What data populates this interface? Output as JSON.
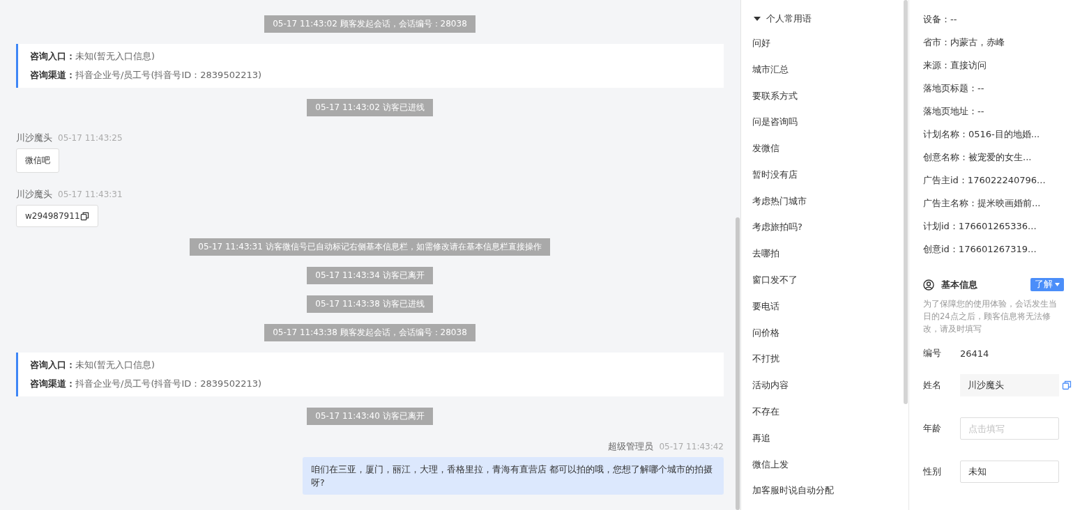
{
  "chat": [
    {
      "kind": "system",
      "text": "05-17 11:43:02 顾客发起会话，会话编号：28038"
    },
    {
      "kind": "info_card",
      "lines": [
        {
          "label": "咨询入口：",
          "value": "未知(暂无入口信息)"
        },
        {
          "label": "咨询渠道：",
          "value": "抖音企业号/员工号(抖音号ID：2839502213)"
        }
      ]
    },
    {
      "kind": "system",
      "text": "05-17 11:43:02 访客已进线"
    },
    {
      "kind": "visitor",
      "name": "川沙魔头",
      "time": "05-17 11:43:25",
      "text": "微信吧",
      "copyable": false
    },
    {
      "kind": "visitor",
      "name": "川沙魔头",
      "time": "05-17 11:43:31",
      "text": "w294987911",
      "copyable": true
    },
    {
      "kind": "system",
      "text": "05-17 11:43:31 访客微信号已自动标记右侧基本信息栏，如需修改请在基本信息栏直接操作"
    },
    {
      "kind": "system",
      "text": "05-17 11:43:34 访客已离开"
    },
    {
      "kind": "system",
      "text": "05-17 11:43:38 访客已进线"
    },
    {
      "kind": "system",
      "text": "05-17 11:43:38 顾客发起会话，会话编号：28038"
    },
    {
      "kind": "info_card",
      "lines": [
        {
          "label": "咨询入口：",
          "value": "未知(暂无入口信息)"
        },
        {
          "label": "咨询渠道：",
          "value": "抖音企业号/员工号(抖音号ID：2839502213)"
        }
      ]
    },
    {
      "kind": "system",
      "text": "05-17 11:43:40 访客已离开"
    },
    {
      "kind": "agent",
      "name": "超级管理员",
      "time": "05-17 11:43:42",
      "text": "咱们在三亚，厦门，丽江，大理，香格里拉，青海有直营店 都可以拍的哦，您想了解哪个城市的拍摄呀?"
    }
  ],
  "phrases": {
    "title": "个人常用语",
    "expanded": true,
    "items": [
      "问好",
      "城市汇总",
      "要联系方式",
      "问是咨询吗",
      "发微信",
      "暂时没有店",
      "考虑热门城市",
      "考虑旅拍吗?",
      "去哪拍",
      "窗口发不了",
      "要电话",
      "问价格",
      "不打扰",
      "活动内容",
      "不存在",
      "再追",
      "微信上发",
      "加客服时说自动分配"
    ]
  },
  "details": [
    "设备：--",
    "省市：内蒙古，赤峰",
    "来源：直接访问",
    "落地页标题：--",
    "落地页地址：--",
    "计划名称：0516-目的地婚...",
    "创意名称：被宠爱的女生...",
    "广告主id：176022240796...",
    "广告主名称：提米映画婚前...",
    "计划id：176601265336...",
    "创意id：176601267319..."
  ],
  "basic_info": {
    "title": "基本信息",
    "button": "了解",
    "note": "为了保障您的使用体验，会话发生当日的24点之后，顾客信息将无法修改，请及时填写",
    "fields": [
      {
        "kind": "text",
        "label": "编号",
        "value": "26414"
      },
      {
        "kind": "readonly",
        "label": "姓名",
        "value": "川沙魔头"
      },
      {
        "kind": "input",
        "label": "年龄",
        "placeholder": "点击填写"
      },
      {
        "kind": "input",
        "label": "性别",
        "value": "未知"
      }
    ]
  }
}
